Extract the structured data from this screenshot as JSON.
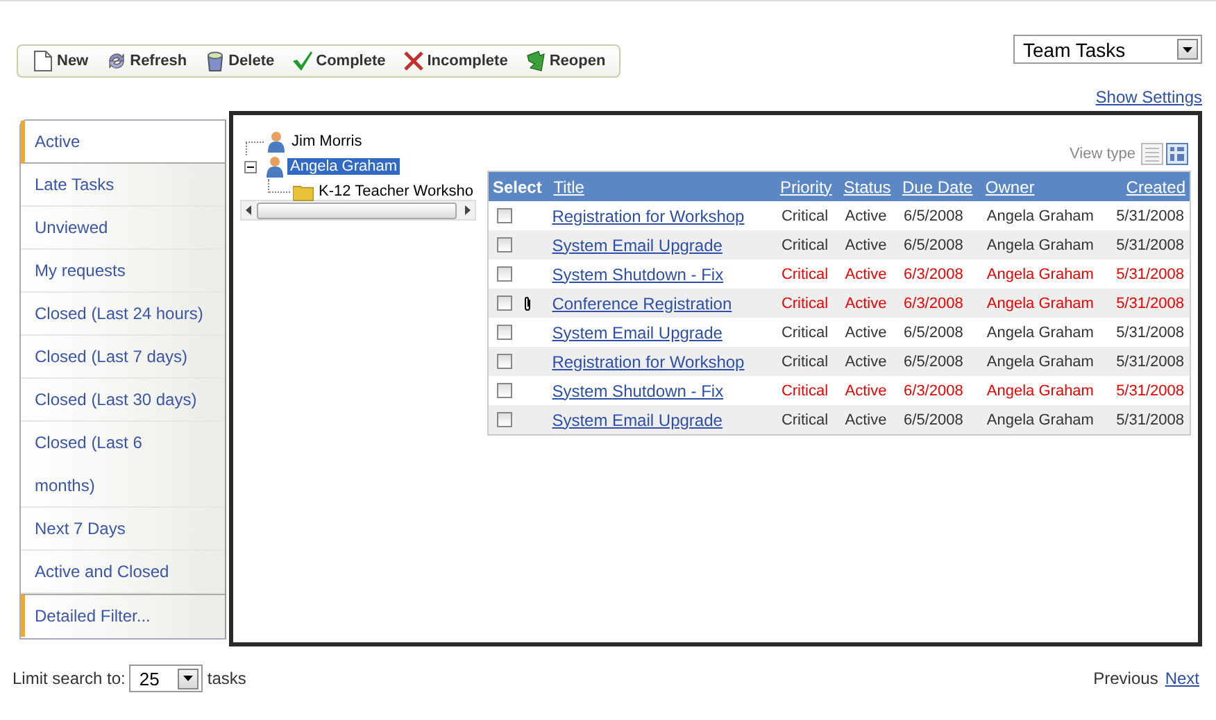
{
  "toolbar": [
    {
      "label": "New",
      "kind": "new"
    },
    {
      "label": "Refresh",
      "kind": "refresh"
    },
    {
      "label": "Delete",
      "kind": "delete"
    },
    {
      "label": "Complete",
      "kind": "complete"
    },
    {
      "label": "Incomplete",
      "kind": "incomplete"
    },
    {
      "label": "Reopen",
      "kind": "reopen"
    }
  ],
  "view_select": {
    "value": "Team Tasks"
  },
  "show_settings": "Show Settings",
  "sidebar": {
    "items": [
      {
        "label": "Active",
        "selected": true,
        "kind": "view"
      },
      {
        "label": "Late Tasks",
        "selected": false,
        "kind": "view"
      },
      {
        "label": "Unviewed",
        "selected": false,
        "kind": "view"
      },
      {
        "label": "My requests",
        "selected": false,
        "kind": "view"
      },
      {
        "label": "Closed (Last 24 hours)",
        "selected": false,
        "kind": "view"
      },
      {
        "label": "Closed (Last 7 days)",
        "selected": false,
        "kind": "view"
      },
      {
        "label": "Closed (Last 30 days)",
        "selected": false,
        "kind": "view"
      },
      {
        "label": "Closed (Last 6\nmonths)",
        "selected": false,
        "kind": "view"
      },
      {
        "label": "Next 7 Days",
        "selected": false,
        "kind": "view"
      },
      {
        "label": "Active and Closed",
        "selected": false,
        "kind": "view"
      },
      {
        "label": "Detailed Filter...",
        "selected": false,
        "kind": "filter"
      }
    ]
  },
  "tree": [
    {
      "label": "Jim Morris",
      "kind": "person",
      "selected": false
    },
    {
      "label": "Angela Graham",
      "kind": "person",
      "selected": true,
      "expanded": true,
      "children": [
        {
          "label": "K-12 Teacher Worksho",
          "kind": "folder",
          "selected": false
        }
      ]
    }
  ],
  "view_type": {
    "label": "View type",
    "options": [
      {
        "kind": "list",
        "selected": false
      },
      {
        "kind": "grid",
        "selected": true
      }
    ]
  },
  "table": {
    "columns": [
      "Select",
      "Title",
      "Priority",
      "Status",
      "Due Date",
      "Owner",
      "Created"
    ],
    "rows": [
      {
        "checked": false,
        "attachment": false,
        "late": false,
        "title": "Registration for Workshop",
        "priority": "Critical",
        "status": "Active",
        "due": "6/5/2008",
        "owner": "Angela Graham",
        "created": "5/31/2008"
      },
      {
        "checked": false,
        "attachment": false,
        "late": false,
        "title": "System Email Upgrade",
        "priority": "Critical",
        "status": "Active",
        "due": "6/5/2008",
        "owner": "Angela Graham",
        "created": "5/31/2008"
      },
      {
        "checked": false,
        "attachment": false,
        "late": true,
        "title": "System Shutdown - Fix",
        "priority": "Critical",
        "status": "Active",
        "due": "6/3/2008",
        "owner": "Angela Graham",
        "created": "5/31/2008"
      },
      {
        "checked": false,
        "attachment": true,
        "late": true,
        "title": "Conference Registration",
        "priority": "Critical",
        "status": "Active",
        "due": "6/3/2008",
        "owner": "Angela Graham",
        "created": "5/31/2008"
      },
      {
        "checked": false,
        "attachment": false,
        "late": false,
        "title": "System Email Upgrade",
        "priority": "Critical",
        "status": "Active",
        "due": "6/5/2008",
        "owner": "Angela Graham",
        "created": "5/31/2008"
      },
      {
        "checked": false,
        "attachment": false,
        "late": false,
        "title": "Registration for Workshop",
        "priority": "Critical",
        "status": "Active",
        "due": "6/5/2008",
        "owner": "Angela Graham",
        "created": "5/31/2008"
      },
      {
        "checked": false,
        "attachment": false,
        "late": true,
        "title": "System Shutdown - Fix",
        "priority": "Critical",
        "status": "Active",
        "due": "6/3/2008",
        "owner": "Angela Graham",
        "created": "5/31/2008"
      },
      {
        "checked": false,
        "attachment": false,
        "late": false,
        "title": "System Email Upgrade",
        "priority": "Critical",
        "status": "Active",
        "due": "6/5/2008",
        "owner": "Angela Graham",
        "created": "5/31/2008"
      }
    ]
  },
  "footer": {
    "limit_label": "Limit search to:",
    "limit_value": "25",
    "limit_suffix": "tasks",
    "previous": "Previous",
    "next": "Next"
  }
}
